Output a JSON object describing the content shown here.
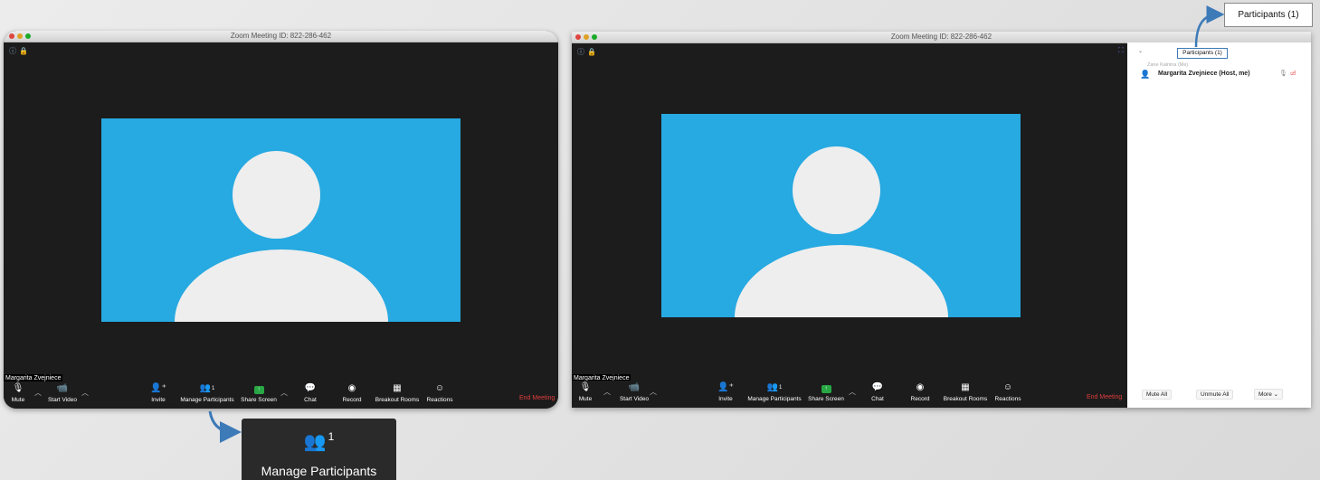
{
  "meeting_title": "Zoom Meeting ID: 822-286-462",
  "participant_name": "Margarita Zvejniece",
  "toolbar": {
    "mute": "Mute",
    "start_video": "Start Video",
    "invite": "Invite",
    "manage_participants": "Manage Participants",
    "participant_count": "1",
    "share_screen": "Share Screen",
    "chat": "Chat",
    "record": "Record",
    "breakout_rooms": "Breakout Rooms",
    "reactions": "Reactions",
    "end_meeting": "End Meeting"
  },
  "panel": {
    "header": "Participants (1)",
    "ghost_text": "Zane Kalnina (Me)",
    "row_name": "Margarita Zvejniece (Host, me)",
    "mute_all": "Mute All",
    "unmute_all": "Unmute All",
    "more": "More ⌄"
  },
  "zoom_inset": {
    "label": "Manage Participants",
    "count": "1"
  },
  "callout": "Participants (1)",
  "colors": {
    "video_bg": "#27a9e1",
    "arrow": "#3d7ab8",
    "end_meeting": "#e03c3c"
  },
  "icons": [
    "mic-icon",
    "video-off-icon",
    "invite-icon",
    "participants-icon",
    "share-screen-icon",
    "chat-icon",
    "record-icon",
    "breakout-rooms-icon",
    "reactions-icon",
    "info-icon",
    "lock-icon",
    "fullscreen-icon"
  ]
}
